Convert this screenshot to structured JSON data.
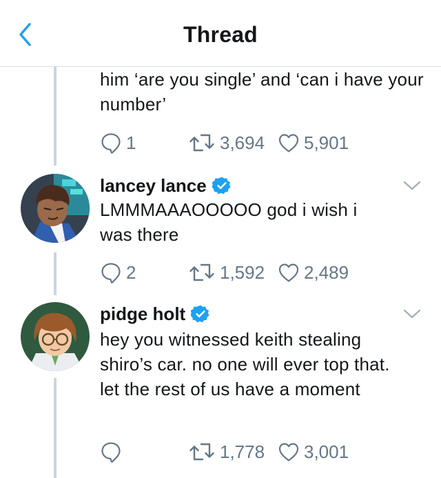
{
  "header": {
    "title": "Thread",
    "back_icon": "chevron-left-icon",
    "accent": "#1da1f2"
  },
  "tweets": [
    {
      "text": "him ‘are you single’ and ‘can i have your number’",
      "reply_count": "1",
      "retweet_count": "3,694",
      "like_count": "5,901"
    },
    {
      "author": "lancey lance",
      "verified": true,
      "text": "LMMMAAAOOOOO god i wish i was there",
      "reply_count": "2",
      "retweet_count": "1,592",
      "like_count": "2,489"
    },
    {
      "author": "pidge holt",
      "verified": true,
      "text": "hey you witnessed keith stealing shiro’s car. no one will ever top that. let the rest of us have a moment",
      "reply_count": "",
      "retweet_count": "1,778",
      "like_count": "3,001"
    }
  ],
  "colors": {
    "icon_gray": "#657786",
    "thread_line": "#cdd4db",
    "verified_blue": "#1da1f2"
  }
}
